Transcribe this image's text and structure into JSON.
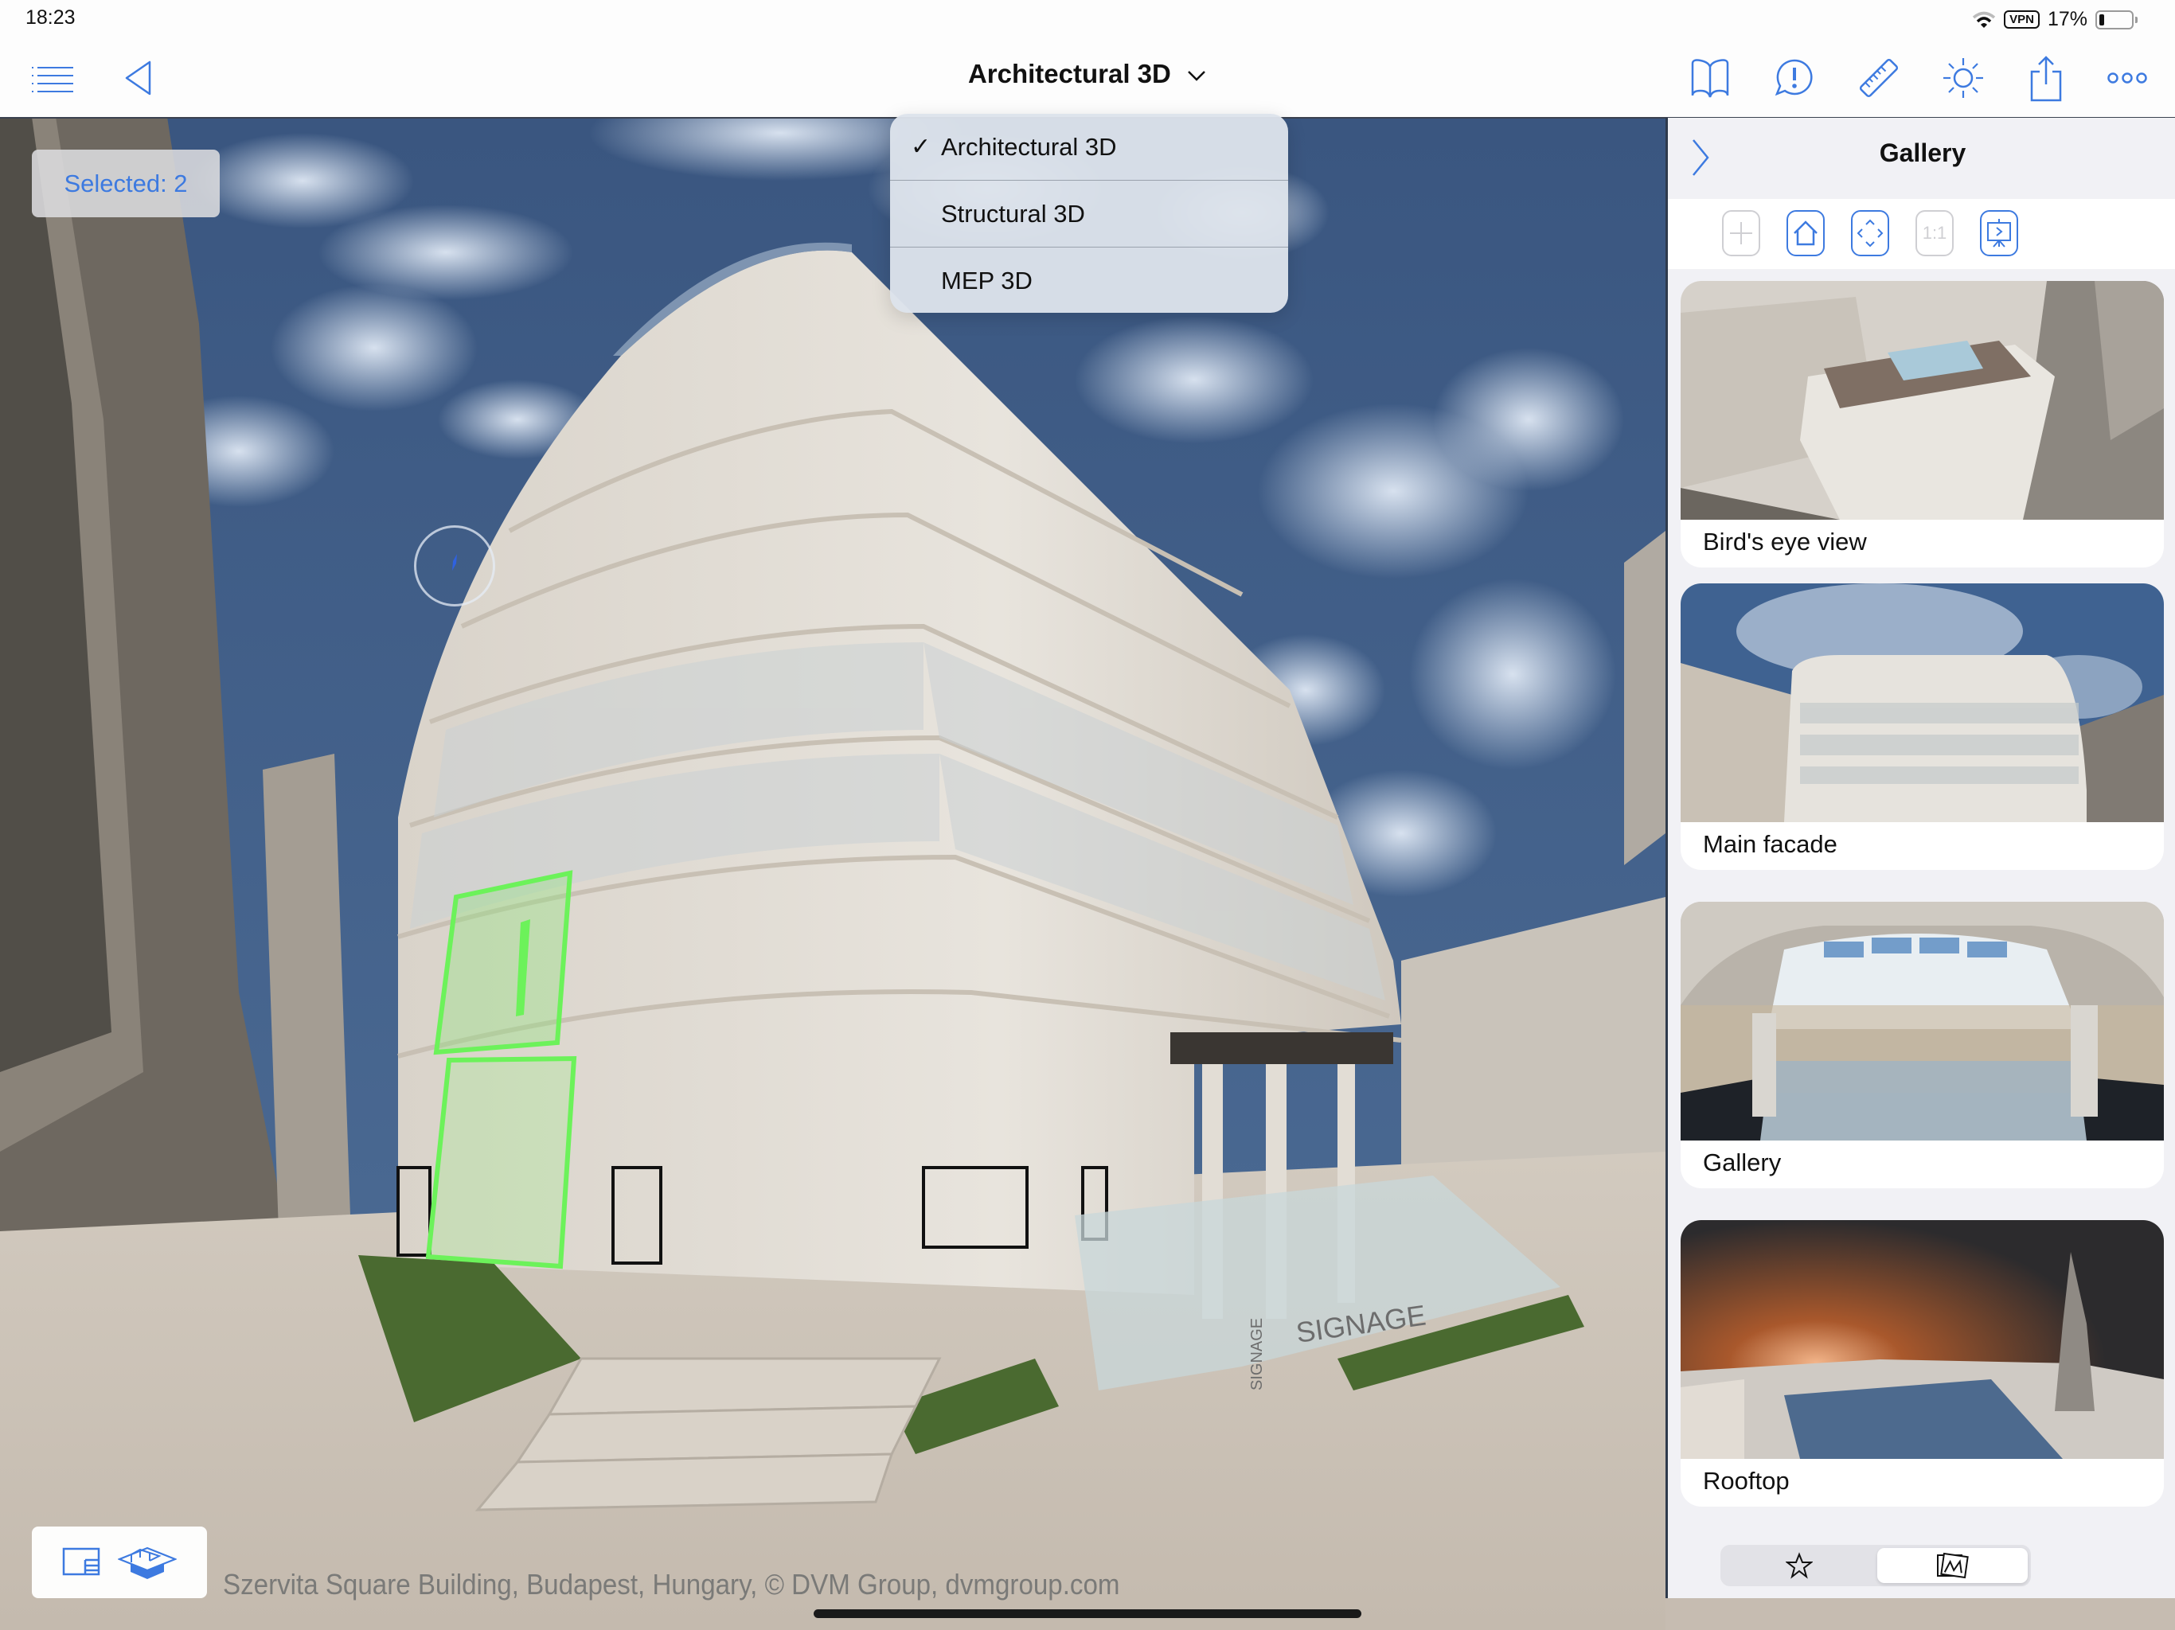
{
  "status_bar": {
    "time": "18:23",
    "vpn_label": "VPN",
    "battery_percent_text": "17%",
    "battery_level": 0.17,
    "icons": [
      "wifi-icon",
      "vpn-badge",
      "battery-icon"
    ]
  },
  "toolbar": {
    "left_icons": [
      "list-icon",
      "back-triangle-icon"
    ],
    "title": "Architectural 3D",
    "title_chevron": "chevron-down-icon",
    "right_icons": [
      "book-icon",
      "issue-bubble-icon",
      "ruler-icon",
      "sun-icon",
      "share-icon",
      "more-icon"
    ]
  },
  "view_menu": {
    "items": [
      {
        "label": "Architectural 3D",
        "checked": true,
        "check_glyph": "✓"
      },
      {
        "label": "Structural 3D",
        "checked": false,
        "check_glyph": ""
      },
      {
        "label": "MEP 3D",
        "checked": false,
        "check_glyph": ""
      }
    ]
  },
  "selection": {
    "label": "Selected: 2",
    "count": 2
  },
  "scene": {
    "signage_text": "SIGNAGE",
    "selection_color": "#6cf25a",
    "sky_color": "#3f5e86"
  },
  "gallery_panel": {
    "title": "Gallery",
    "tools": [
      {
        "name": "add-view-button",
        "icon": "plus-icon",
        "enabled": false
      },
      {
        "name": "home-view-button",
        "icon": "home-icon",
        "enabled": true
      },
      {
        "name": "fit-view-button",
        "icon": "fit-arrows-icon",
        "enabled": true
      },
      {
        "name": "one-to-one-button",
        "icon": "one-to-one-icon",
        "label": "1:1",
        "enabled": false
      },
      {
        "name": "presentation-button",
        "icon": "presentation-icon",
        "enabled": true
      }
    ],
    "cards": [
      {
        "caption": "Bird's eye view"
      },
      {
        "caption": "Main facade"
      },
      {
        "caption": "Gallery"
      },
      {
        "caption": "Rooftop"
      }
    ],
    "segments": [
      {
        "icon": "star-icon",
        "active": false
      },
      {
        "icon": "gallery-images-icon",
        "active": true
      }
    ]
  },
  "bottom_tools": {
    "icons": [
      "floorplan-icon",
      "section-box-icon"
    ]
  },
  "copyright": "Szervita Square Building, Budapest, Hungary, © DVM Group, dvmgroup.com",
  "colors": {
    "accent": "#3d7ae0",
    "panel_bg": "#f1f1f5",
    "menu_bg": "#dde3eb"
  }
}
